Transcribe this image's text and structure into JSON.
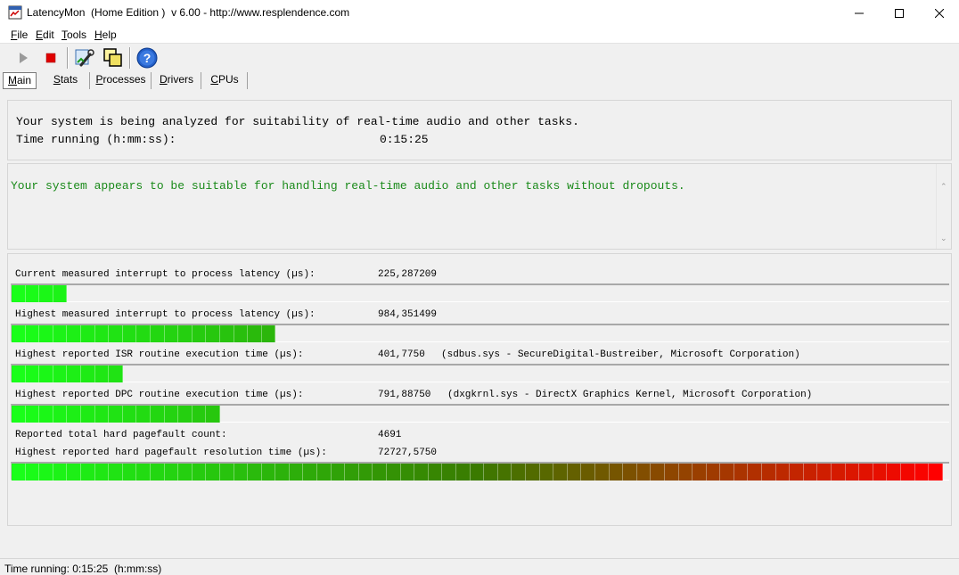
{
  "window": {
    "title": "LatencyMon  (Home Edition )  v 6.00 - http://www.resplendence.com"
  },
  "menu": [
    {
      "label": "File",
      "accel": "F",
      "rest": "ile"
    },
    {
      "label": "Edit",
      "accel": "E",
      "rest": "dit"
    },
    {
      "label": "Tools",
      "accel": "T",
      "rest": "ools"
    },
    {
      "label": "Help",
      "accel": "H",
      "rest": "elp"
    }
  ],
  "toolbar": [
    {
      "name": "start-monitor-button",
      "icon": "play-icon"
    },
    {
      "name": "stop-monitor-button",
      "icon": "stop-icon"
    },
    {
      "name": "tool-button",
      "icon": "wrench-icon"
    },
    {
      "name": "windows-button",
      "icon": "windows-icon"
    },
    {
      "name": "help-button",
      "icon": "help-icon"
    }
  ],
  "tabs": [
    {
      "label": "Main",
      "accel": "M",
      "rest": "ain",
      "selected": true
    },
    {
      "label": "Stats",
      "accel": "S",
      "rest": "tats",
      "selected": false
    },
    {
      "label": "Processes",
      "accel": "P",
      "rest": "rocesses",
      "selected": false
    },
    {
      "label": "Drivers",
      "accel": "D",
      "rest": "rivers",
      "selected": false
    },
    {
      "label": "CPUs",
      "accel": "C",
      "rest": "PUs",
      "selected": false
    }
  ],
  "status": {
    "analyzing_text": "Your system is being analyzed for suitability of real-time audio and other tasks.",
    "time_label": "Time running (h:mm:ss):",
    "time_value": "0:15:25"
  },
  "verdict": {
    "text": "Your system appears to be suitable for handling real-time audio and other tasks without dropouts.",
    "color": "#1a8a1a"
  },
  "metrics": [
    {
      "label": "Current measured interrupt to process latency (µs):",
      "value": "225,287209",
      "detail": "",
      "meter_fraction": 0.059
    },
    {
      "label": "Highest measured interrupt to process latency (µs):",
      "value": "984,351499",
      "detail": "",
      "meter_fraction": 0.287
    },
    {
      "label": "Highest reported ISR routine execution time (µs):",
      "value": "401,7750",
      "detail": "(sdbus.sys - SecureDigital-Bustreiber, Microsoft Corporation)",
      "meter_fraction": 0.119
    },
    {
      "label": "Highest reported DPC routine execution time (µs):",
      "value": "791,88750",
      "detail": "(dxgkrnl.sys - DirectX Graphics Kernel, Microsoft Corporation)",
      "meter_fraction": 0.227
    },
    {
      "label": "Reported total hard pagefault count:",
      "value": "4691",
      "detail": "",
      "meter_fraction": null
    },
    {
      "label": "Highest reported hard pagefault resolution time (µs):",
      "value": "72727,5750",
      "detail": "",
      "meter_fraction": 1.0
    }
  ],
  "meter_colors": {
    "low": "#19ff19",
    "mid": "#3a7a00",
    "high": "#ff0000"
  },
  "statusbar": {
    "text": "Time running: 0:15:25  (h:mm:ss)"
  }
}
